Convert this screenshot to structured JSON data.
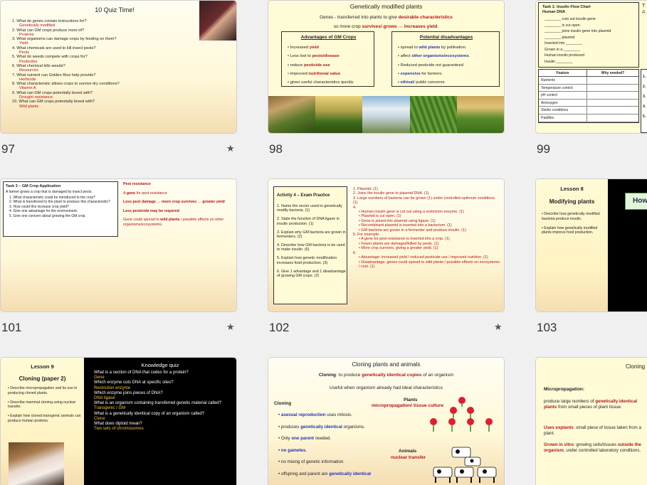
{
  "slides": {
    "s97": {
      "number": "97",
      "title": "10 Quiz Time!",
      "qa": [
        {
          "q": "1.  What do genes contain instructions for?",
          "a": "Genetically modified"
        },
        {
          "q": "2.  What can GM crops produce more of?",
          "a": "Proteins"
        },
        {
          "q": "3.  What organisms can damage crops by feeding on them?",
          "a": "Yield"
        },
        {
          "q": "4.  What chemicals are used to kill insect pests?",
          "a": "Pests"
        },
        {
          "q": "5.  What do weeds compete with crops for?",
          "a": "Pesticides"
        },
        {
          "q": "6.  What chemical kills weeds?",
          "a": "Resources"
        },
        {
          "q": "7.  What nutrient can Golden Rice help provide?",
          "a": "Herbicide"
        },
        {
          "q": "8.  What characteristic allows crops to survive dry conditions?",
          "a": "Vitamin A"
        },
        {
          "q": "9.  What can GM crops potentially breed with?",
          "a": "Drought resistance"
        },
        {
          "q": "10. What can GM crops potentially breed with?",
          "a": "Wild plants"
        }
      ]
    },
    "s98": {
      "number": "98",
      "title": "Genetically modified plants",
      "def_plain": "Genes - transferred into plants to give ",
      "def_red": "desirable characteristics",
      "line2_a": "so more crop ",
      "line2_red": "survives/ grows",
      "line2_b": " → ",
      "line2_red2": "increases yield",
      "line2_c": ".",
      "adv_title": "Advantages of GM Crops",
      "adv": [
        {
          "pre": "Increased ",
          "hl": "yield",
          "post": "",
          "c": "red"
        },
        {
          "pre": "Less lost to ",
          "hl": "pests/disease",
          "post": "",
          "c": "red"
        },
        {
          "pre": "reduce ",
          "hl": "pesticide use",
          "post": "",
          "c": "red"
        },
        {
          "pre": "Improved ",
          "hl": "nutritional value",
          "post": "",
          "c": "red"
        },
        {
          "pre": "given useful characteristics quickly",
          "hl": "",
          "post": "",
          "c": "red"
        }
      ],
      "dis_title": "Potential disadvantages",
      "dis": [
        {
          "pre": "spread to ",
          "hl": "wild plants",
          "post": " by pollination.",
          "c": "blue"
        },
        {
          "pre": "affect ",
          "hl": "other organisms/ecosystems",
          "post": ".",
          "c": "blue"
        },
        {
          "pre": "Reduced pesticide not guaranteed",
          "hl": "",
          "post": "",
          "c": "blue"
        },
        {
          "pre": "",
          "hl": "expensive",
          "post": " for farmers.",
          "c": "blue"
        },
        {
          "pre": "",
          "hl": "ethical",
          "post": "/ public concerns",
          "c": "blue"
        }
      ]
    },
    "s99": {
      "number": "99",
      "task_title": "Task 1: Insulin Flow Chart",
      "task_sub": "Human DNA",
      "lines": [
        "________ cuts out insulin gene",
        "________ is cut open",
        "________ joins insulin gene into plasmid",
        "________ plasmid",
        "Inserted into ________",
        "Grown in a ________",
        "Human insulin produced",
        "Insulin ________"
      ],
      "table_head": [
        "Feature",
        "Why needed?"
      ],
      "table_rows": [
        "Nutrients",
        "Temperature control",
        "pH control",
        "Air/oxygen",
        "Sterile conditions",
        "Paddles"
      ],
      "side_letter": "A",
      "side_letter2": "T",
      "side_items": [
        "1.",
        "2.",
        "3.",
        "4.",
        "5."
      ]
    },
    "s101": {
      "number": "101",
      "task_title": "Task 3 – GM Crop Application",
      "intro": "A farmer grows a crop that is damaged by insect pests.",
      "qs": [
        "1.   What characteristic could be introduced to the crop?",
        "2.   What is transferred to the plant to produce this characteristic?",
        "3.   How could this increase crop yield?",
        "4.   Give one advantage for the environment.",
        "5.   Give one concern about growing the GM crop."
      ],
      "ans1": "Pest resistance",
      "ans2a": "A ",
      "ans2b": "gene",
      "ans2c": " for pest resistance",
      "ans3": "Less pest damage → more crop survives → greater yield",
      "ans4": "Less pesticide may be required",
      "ans5a": "Gene could spread to ",
      "ans5b": "wild plants",
      "ans5c": " / possible effects on other organisms/ecosystems."
    },
    "s102": {
      "number": "102",
      "activity_title": "Activity 4 – Exam Practice",
      "qs": [
        "1. Name the vector used to genetically modify bacteria. (1)",
        "2. State the function of DNA ligase in insulin production. (1)",
        "3. Explain why GM bacteria are grown in fermenters. (2)",
        "4. Describe how GM bacteria is be used to make insulin. (6)",
        "5. Explain how genetic modification increases food production. (3)",
        "6. Give 1 advantage and 1 disadvantage of growing GM crops. (2)"
      ],
      "answers": [
        "1. Plasmid. (1)",
        "2. Joins the insulin gene to plasmid DNA. (1)",
        "3. Large numbers of bacteria can be grown (1) under controlled optimum conditions. (1)",
        "4.",
        "• Human insulin gene is cut out using a restriction enzyme. (1)",
        "• Plasmid is cut open. (1)",
        "• Gene is joined into plasmid using ligase. (1)",
        "• Recombinant plasmid is inserted into a bacterium. (1)",
        "• GM bacteria are grown in a fermenter and produce insulin. (1)",
        "5. For example:",
        "• A gene for pest resistance is inserted into a crop. (1)",
        "• Fewer plants are damaged/killed by pests. (1)",
        "• More crop survives, giving a greater yield. (1)",
        "6.",
        "• Advantage: increased yield / reduced pesticide use / improved nutrition. (1)",
        "• Disadvantage: genes could spread to wild plants / possible effects on ecosystems / cost. (1)"
      ]
    },
    "s103": {
      "number": "103",
      "lesson": "Lesson 8",
      "title": "Modifying plants",
      "bullets": [
        "Describe how genetically modified bacteria produce insulin.",
        "Explain how genetically modified plants improve food production."
      ],
      "green_text": "How"
    },
    "s104": {
      "lesson": "Lesson 9",
      "title": "Cloning (paper 2)",
      "bullets": [
        "Describe micropropagation and its use in producing cloned plants.",
        "Describe mammal cloning using nuclear transfer.",
        "Explain how cloned transgenic animals can produce human proteins."
      ],
      "quiz_title": "Knowledge quiz",
      "qa": [
        {
          "q": "What is a section of DNA that codes for a protein?",
          "a": "Gene"
        },
        {
          "q": "Which enzyme cuts DNA at specific sites?",
          "a": "Restriction enzyme"
        },
        {
          "q": "Which enzyme joins pieces of DNA?",
          "a": "DNA ligase"
        },
        {
          "q": "What is an organism containing transferred genetic material called?",
          "a": "Transgenic / GM"
        },
        {
          "q": "What is a genetically identical copy of an organism called?",
          "a": "Clone"
        },
        {
          "q": "What does diploid mean?",
          "a": "Two sets of chromosomes"
        }
      ]
    },
    "s105": {
      "title": "Cloning plants and animals",
      "def_a": "Cloning",
      "def_b": ": to produce ",
      "def_c": "genetically identical copies",
      "def_d": " of an organism",
      "sub": "Useful when organism already had ideal characteristics",
      "cloning_head": "Cloning",
      "plants_head": "Plants",
      "plants_sub": "micropropagation/ tissue culture",
      "animals_head": "Animals",
      "animals_sub": "nuclear transfer",
      "bullets": [
        {
          "pre": "",
          "hl": "asexual reproduction",
          "post": " uses mitosis."
        },
        {
          "pre": "produces ",
          "hl": "genetically identical",
          "post": " organisms."
        },
        {
          "pre": "Only ",
          "hl": "one parent",
          "post": " needed."
        },
        {
          "pre": "",
          "hl": "no gametes",
          "post": "."
        },
        {
          "pre": "no mixing of genetic information.",
          "hl": "",
          "post": ""
        },
        {
          "pre": "offspring and parent are ",
          "hl": "genetically identical",
          "post": ""
        }
      ]
    },
    "s106": {
      "title": "Cloning",
      "micro_head": "Micropropagation:",
      "micro_a": "produce large numbers of ",
      "micro_b": "genetically identical plants",
      "micro_c": " from small pieces of plant tissue.",
      "exp_a": "Uses explants",
      "exp_b": ": small piece of tissue taken from a plant.",
      "vit_a": "Grown in vitro",
      "vit_b": ": growing cells/tissues ",
      "vit_c": "outside the organism",
      "vit_d": ", under controlled laboratory conditions."
    }
  }
}
